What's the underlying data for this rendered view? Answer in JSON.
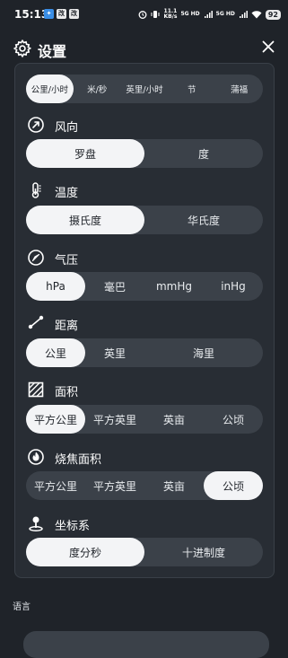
{
  "status_bar": {
    "time": "15:13",
    "net_speed_value": "11.1",
    "net_speed_unit": "KB/s",
    "sig1": "5G HD",
    "sig2": "5G HD",
    "battery": "92"
  },
  "header": {
    "title": "设置",
    "icon": "gear-icon",
    "close_icon": "close-icon"
  },
  "sections": {
    "speed": {
      "options": [
        "公里/小时",
        "米/秒",
        "英里/小时",
        "节",
        "蒲福"
      ],
      "selected": 0
    },
    "wind_direction": {
      "label": "风向",
      "icon": "compass-arrow-icon",
      "options": [
        "罗盘",
        "度"
      ],
      "selected": 0
    },
    "temperature": {
      "label": "温度",
      "icon": "thermometer-icon",
      "options": [
        "摄氏度",
        "华氏度"
      ],
      "selected": 0
    },
    "pressure": {
      "label": "气压",
      "icon": "gauge-icon",
      "options": [
        "hPa",
        "毫巴",
        "mmHg",
        "inHg"
      ],
      "selected": 0
    },
    "distance": {
      "label": "距离",
      "icon": "distance-icon",
      "options": [
        "公里",
        "英里",
        "海里"
      ],
      "selected": 0
    },
    "area": {
      "label": "面积",
      "icon": "area-icon",
      "options": [
        "平方公里",
        "平方英里",
        "英亩",
        "公顷"
      ],
      "selected": 0
    },
    "burned_area": {
      "label": "烧焦面积",
      "icon": "fire-icon",
      "options": [
        "平方公里",
        "平方英里",
        "英亩",
        "公顷"
      ],
      "selected": 3
    },
    "coordinates": {
      "label": "坐标系",
      "icon": "location-pin-icon",
      "options": [
        "度分秒",
        "十进制度"
      ],
      "selected": 0
    }
  },
  "language": {
    "label": "语言"
  }
}
